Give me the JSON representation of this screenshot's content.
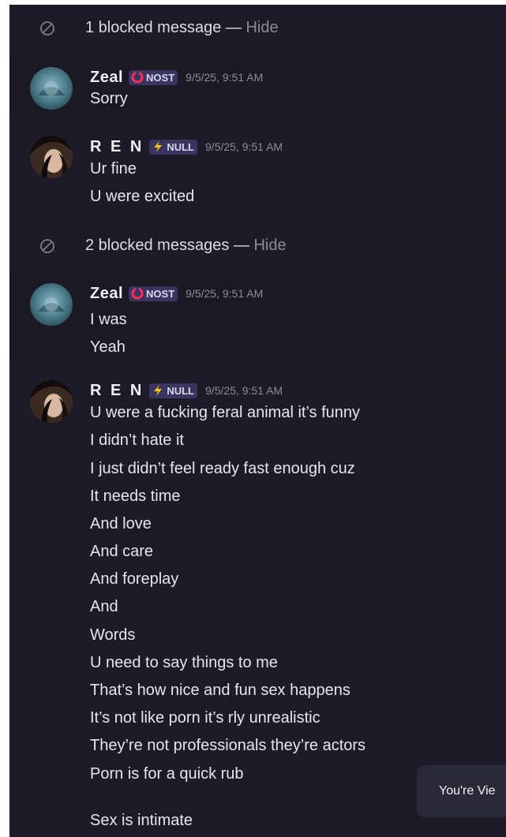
{
  "blocked_1": {
    "text": "1 blocked message — ",
    "hide": "Hide"
  },
  "blocked_2": {
    "text": "2 blocked messages — ",
    "hide": "Hide"
  },
  "users": {
    "zeal": {
      "name": "Zeal",
      "badge": "NOST",
      "badge_icon": "red-ring-icon"
    },
    "ren": {
      "name": "R E N",
      "badge": "NULL",
      "badge_icon": "lightning-icon"
    }
  },
  "messages": [
    {
      "author": "Zeal",
      "timestamp": "9/5/25, 9:51 AM",
      "lines": [
        "Sorry"
      ]
    },
    {
      "author": "R E N",
      "timestamp": "9/5/25, 9:51 AM",
      "lines": [
        "Ur fine",
        "U were excited"
      ]
    },
    {
      "author": "Zeal",
      "timestamp": "9/5/25, 9:51 AM",
      "lines": [
        "I was",
        "Yeah"
      ]
    },
    {
      "author": "R E N",
      "timestamp": "9/5/25, 9:51 AM",
      "lines": [
        "U were a fucking feral animal it’s funny",
        "I didn’t hate it",
        "I just didn’t feel ready fast enough cuz",
        "It needs time",
        "And love",
        "And care",
        "And foreplay",
        "And",
        "Words",
        "U need to say things to me",
        "That’s how nice and fun sex happens",
        "It’s not like porn it’s rly unrealistic",
        "They’re not professionals they’re actors",
        "Porn is for a quick rub",
        "Sex is intimate"
      ]
    }
  ],
  "toast": {
    "text": "You're Vie"
  },
  "colors": {
    "background": "#1c1b27",
    "badge_bg": "#3a3560",
    "muted": "#8a8a99"
  }
}
